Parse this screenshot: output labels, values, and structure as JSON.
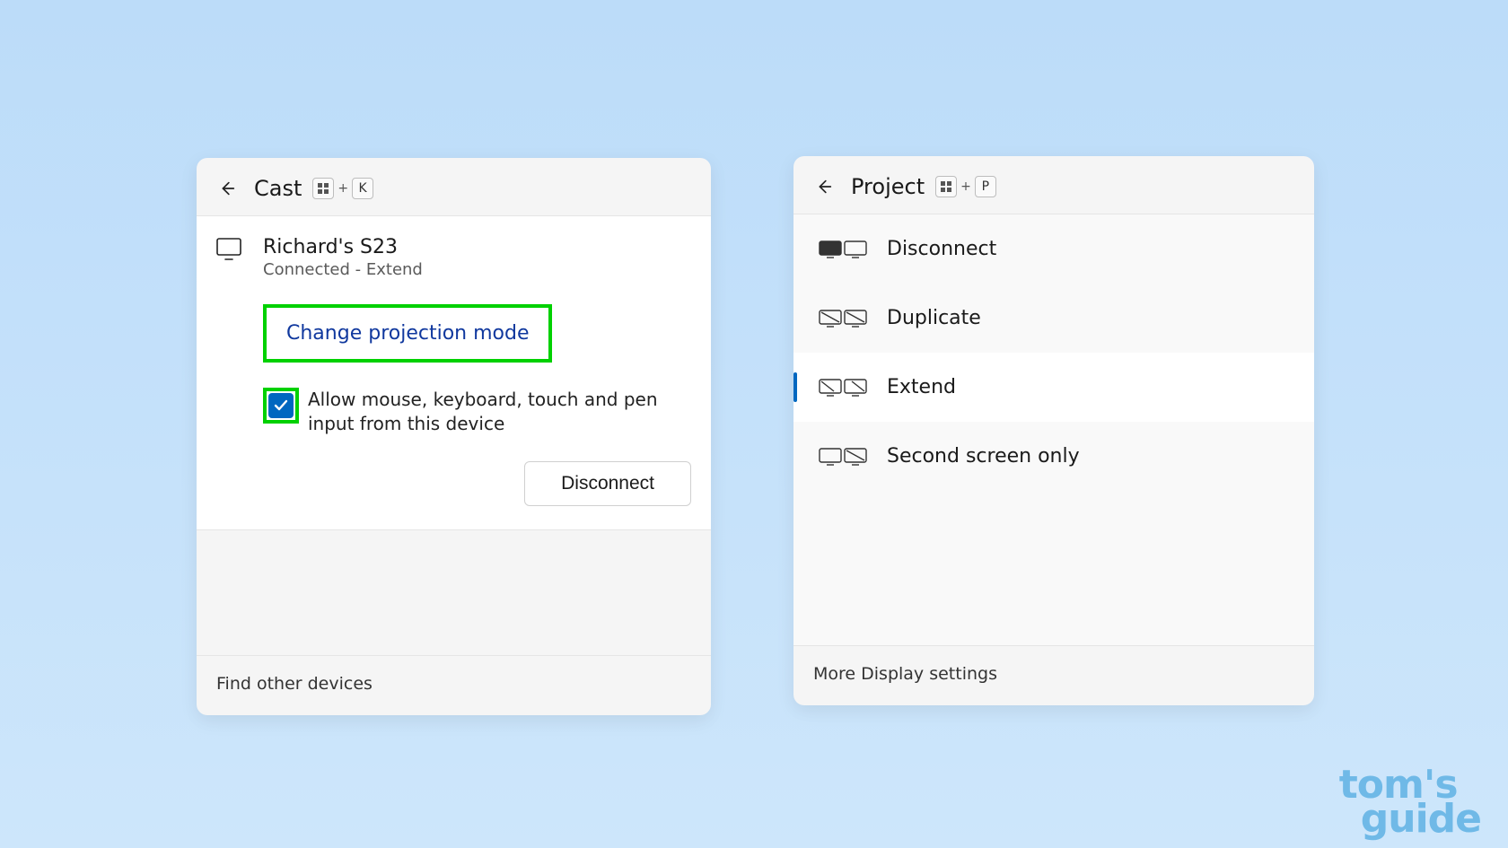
{
  "cast": {
    "title": "Cast",
    "shortcut": {
      "modifier": "win",
      "plus": "+",
      "key": "K"
    },
    "device": {
      "name": "Richard's S23",
      "status": "Connected - Extend"
    },
    "change_mode_label": "Change projection mode",
    "allow_input_label": "Allow mouse, keyboard, touch and pen input from this device",
    "allow_input_checked": true,
    "disconnect_label": "Disconnect",
    "footer_label": "Find other devices"
  },
  "project": {
    "title": "Project",
    "shortcut": {
      "modifier": "win",
      "plus": "+",
      "key": "P"
    },
    "options": [
      {
        "id": "disconnect",
        "label": "Disconnect",
        "selected": false
      },
      {
        "id": "duplicate",
        "label": "Duplicate",
        "selected": false
      },
      {
        "id": "extend",
        "label": "Extend",
        "selected": true
      },
      {
        "id": "second-only",
        "label": "Second screen only",
        "selected": false
      }
    ],
    "footer_label": "More Display settings"
  },
  "watermark": {
    "line1": "tom's",
    "line2": "guide"
  }
}
